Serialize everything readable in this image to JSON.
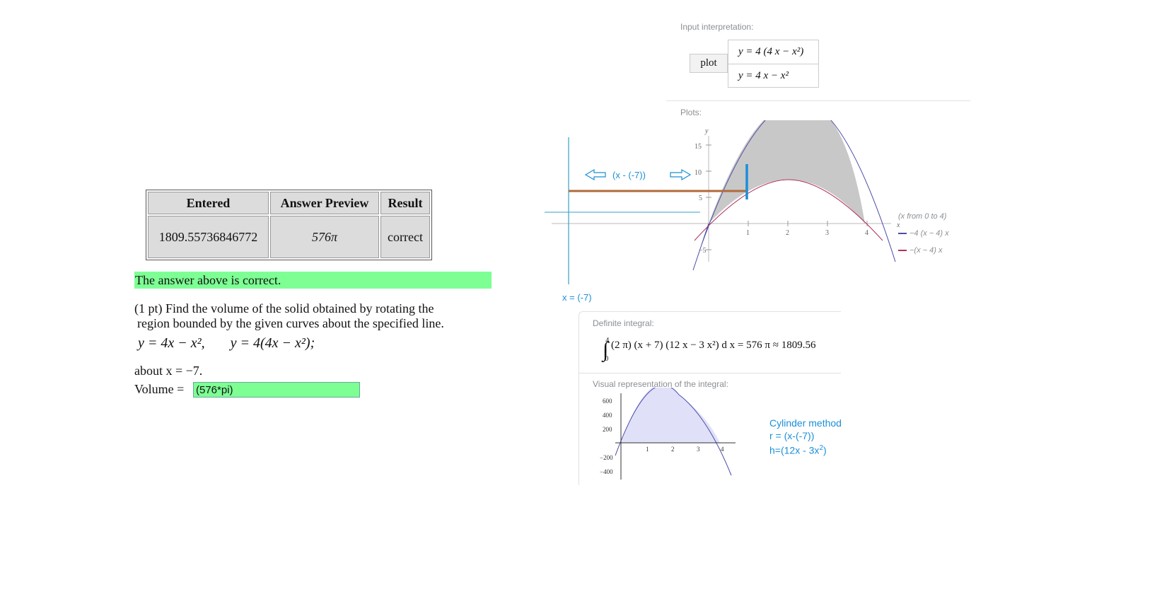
{
  "result_table": {
    "headers": [
      "Entered",
      "Answer Preview",
      "Result"
    ],
    "row": {
      "entered": "1809.55736846772",
      "preview": "576π",
      "result": "correct"
    }
  },
  "feedback": "The answer above is correct.",
  "problem": {
    "line1": "(1 pt) Find the volume of the solid obtained by rotating the",
    "line2": "region bounded by the given curves about the specified line.",
    "eq1": "y = 4x − x²,",
    "eq2": "y = 4(4x − x²);",
    "about": "about x = −7.",
    "volume_label": "Volume =",
    "volume_value": "(576*pi)"
  },
  "wolfram": {
    "input_title": "Input interpretation:",
    "plot_label": "plot",
    "func1": "y = 4 (4 x − x²)",
    "func2": "y = 4 x − x²",
    "plots_title": "Plots:",
    "axis_y": "y",
    "axis_x": "x",
    "y_ticks": [
      "15",
      "10",
      "5",
      "−5"
    ],
    "x_ticks": [
      "1",
      "2",
      "3",
      "4"
    ],
    "legend_range": "(x from 0 to 4)",
    "legend1": "−4 (x − 4) x",
    "legend2": "−(x − 4) x",
    "radius_annotation": "(x - (-7))",
    "axis_line_label": "x = (-7)",
    "definite_title": "Definite integral:",
    "integral_lower": "0",
    "integral_upper": "4",
    "integral_expr": "(2 π) (x + 7) (12 x − 3 x²) d x = 576 π ≈ 1809.56",
    "visual_title": "Visual representation of the integral:",
    "visual_y_ticks": [
      "600",
      "400",
      "200",
      "−200",
      "−400"
    ],
    "visual_x_ticks": [
      "1",
      "2",
      "3",
      "4"
    ],
    "cylinder_title": "Cylinder method",
    "cylinder_r": "r = (x-(-7))",
    "cylinder_h": "h=(12x - 3x",
    "cylinder_h_sup": "2",
    "cylinder_h_end": ")"
  },
  "colors": {
    "green": "#7dff94",
    "blue_annot": "#1a8fd8",
    "curve_purple": "#4b4ba8",
    "curve_pink": "#b03060",
    "fill_gray": "#c8c8c8",
    "fill_lavender": "#e0e0f8",
    "rod_brown": "#b06a3a"
  }
}
